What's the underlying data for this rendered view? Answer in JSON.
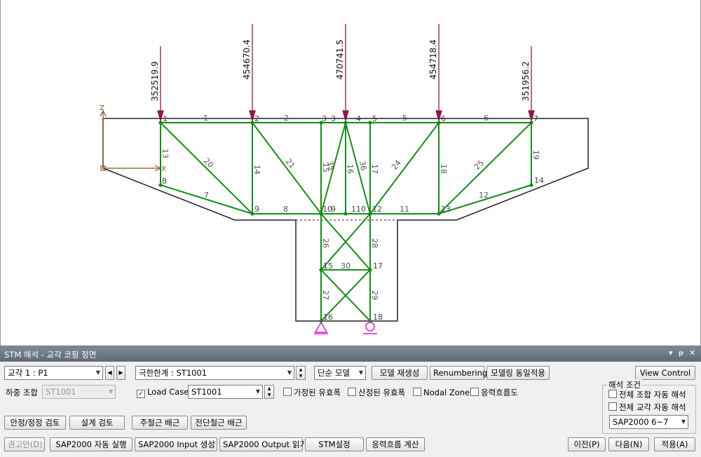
{
  "drawing": {
    "axis": {
      "z": "Z",
      "x": "X"
    },
    "loads": [
      "352519.9",
      "454670.4",
      "470741.5",
      "454718.4",
      "351956.2"
    ],
    "node_labels": [
      "1",
      "2",
      "3",
      "3",
      "4",
      "5",
      "6",
      "7",
      "8",
      "9",
      "10",
      "9",
      "110",
      "12",
      "13",
      "14",
      "15",
      "17",
      "16",
      "18"
    ],
    "member_labels": [
      "1",
      "2",
      "5",
      "6",
      "13",
      "20",
      "14",
      "21",
      "15",
      "35",
      "16",
      "36",
      "17",
      "24",
      "18",
      "25",
      "19",
      "7",
      "12",
      "8",
      "11",
      "26",
      "28",
      "30",
      "27",
      "29"
    ],
    "colors": {
      "member": "#1a8a1a",
      "load": "#8b1a4e",
      "outline": "#222222",
      "support": "#e21ad4",
      "axis": "#7a5520"
    }
  },
  "panel": {
    "title": "STM 해석 - 교각 코핑 정면",
    "title_controls": {
      "pin": "▾",
      "float": "ᵽ",
      "close": "✕"
    },
    "pier_combo": "교각 1 : P1",
    "limit_combo": "극한한계 : ST1001",
    "model_combo": "단순 모델",
    "btn_regen": "모델 재생성",
    "btn_renumber": "Renumbering",
    "btn_same": "모델링 동일적용",
    "btn_view": "View Control",
    "load_combo_label": "하중 조합",
    "load_combo_value": "ST1001",
    "load_case_label": "Load Case",
    "load_case_value": "ST1001",
    "chk_assumed": "가정된 유효폭",
    "chk_calc": "산정된 유효폭",
    "chk_nodal": "Nodal Zone",
    "chk_flow": "응력흐름도",
    "analysis_group": "해석 조건",
    "chk_all_combo": "전체 조합 자동 해석",
    "chk_all_pier": "전체 교각 자동 해석",
    "sap_version": "SAP2000 6~7",
    "btn_stability": "안정/정정 검토",
    "btn_design": "설계 검토",
    "btn_main_rebar": "주철근 배근",
    "btn_shear_rebar": "전단철근 배근",
    "btn_recommend": "권고안(D)",
    "btn_sap_run": "SAP2000 자동 실행",
    "btn_sap_input": "SAP2000 Input 생성",
    "btn_sap_output": "SAP2000 Output 읽기",
    "btn_stm": "STM설정",
    "btn_stress": "응력흐름 계산",
    "btn_prev": "이전(P)",
    "btn_next": "다음(N)",
    "btn_apply": "적용(A)",
    "nav_left": "◀",
    "nav_right": "▶"
  }
}
